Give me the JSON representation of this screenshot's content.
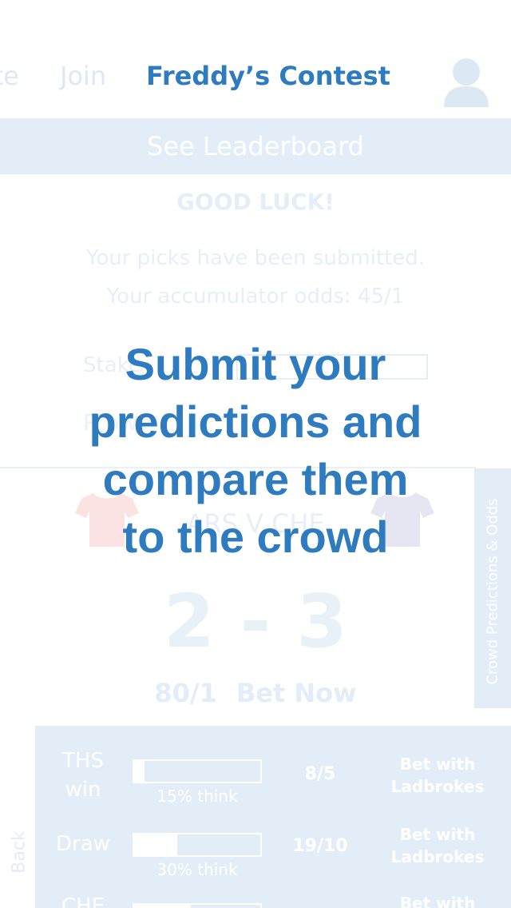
{
  "nav": {
    "partial_tab": "ate",
    "join_tab": "Join",
    "title": "Freddy’s Contest"
  },
  "leaderboard": {
    "label": "See Leaderboard"
  },
  "status": {
    "heading": "GOOD LUCK!",
    "line1": "Your picks have been submitted.",
    "line2": "Your accumulator odds: 45/1",
    "stake_label": "Stake",
    "ghost_row": "R                                              ow"
  },
  "match": {
    "name": "ARS V CHE",
    "score": "2 - 3",
    "odds": "80/1",
    "bet_now": "Bet Now"
  },
  "side_tab": {
    "label": "Crowd Predictions & Odds"
  },
  "panel": {
    "back_label": "Back",
    "rows": [
      {
        "label": "THS win",
        "fill": 0.08,
        "percent_text": "15% think",
        "odds": "8/5",
        "bet": "Bet with Ladbrokes"
      },
      {
        "label": "Draw",
        "fill": 0.34,
        "percent_text": "30% think",
        "odds": "19/10",
        "bet": "Bet with Ladbrokes"
      },
      {
        "label": "CHE",
        "fill": 0.45,
        "percent_text": "",
        "odds": "",
        "bet": "Bet with"
      }
    ]
  },
  "overlay": {
    "lines": [
      "Submit your",
      "predictions and",
      "compare them",
      "to the crowd"
    ]
  },
  "colors": {
    "brand_blue": "#2e7bbf",
    "faded_blue": "#e2edf8",
    "home_shirt": "#fbe3e3",
    "away_shirt": "#e6e6f3"
  },
  "icons": {
    "avatar": "user-avatar-icon",
    "home_shirt": "shirt-icon",
    "away_shirt": "shirt-icon"
  }
}
